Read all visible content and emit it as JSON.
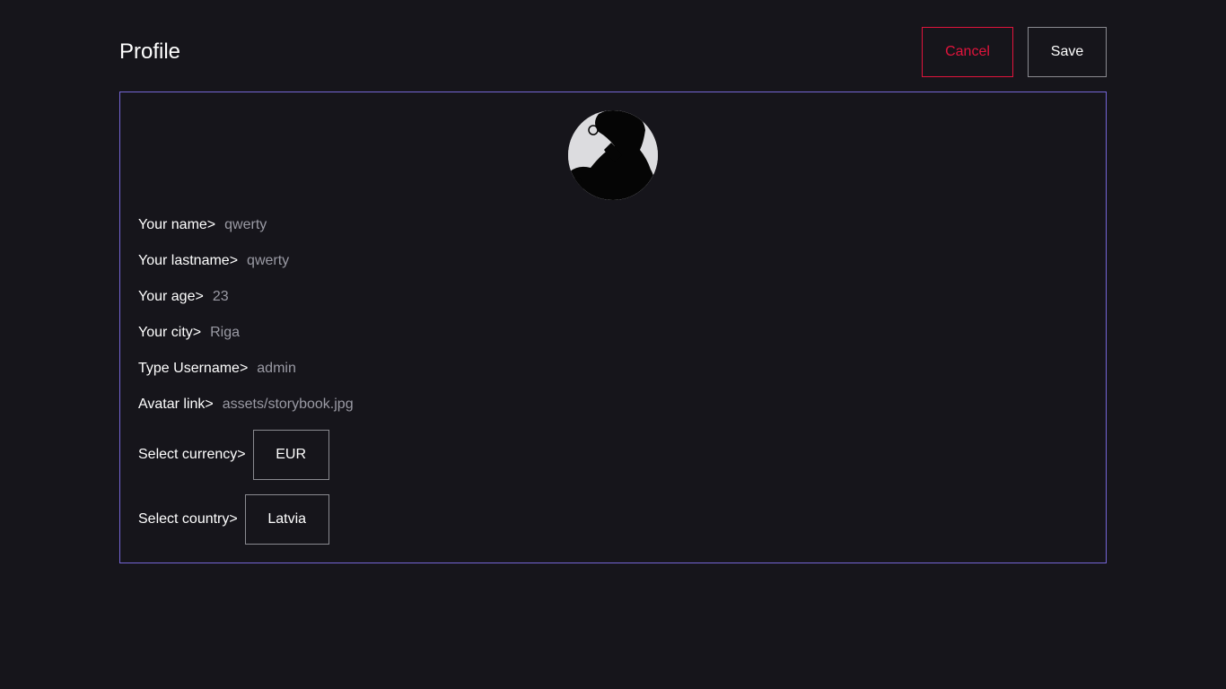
{
  "header": {
    "title": "Profile",
    "cancel_label": "Cancel",
    "save_label": "Save"
  },
  "colors": {
    "background": "#16151b",
    "cancel": "#e0143c",
    "card_border": "#7566d6",
    "value_text": "#9a9aa4"
  },
  "form": {
    "name": {
      "label": "Your name>",
      "value": "qwerty"
    },
    "lastname": {
      "label": "Your lastname>",
      "value": "qwerty"
    },
    "age": {
      "label": "Your age>",
      "value": "23"
    },
    "city": {
      "label": "Your city>",
      "value": "Riga"
    },
    "username": {
      "label": "Type Username>",
      "value": "admin"
    },
    "avatar": {
      "label": "Avatar link>",
      "value": "assets/storybook.jpg"
    },
    "currency": {
      "label": "Select currency>",
      "value": "EUR"
    },
    "country": {
      "label": "Select country>",
      "value": "Latvia"
    }
  }
}
